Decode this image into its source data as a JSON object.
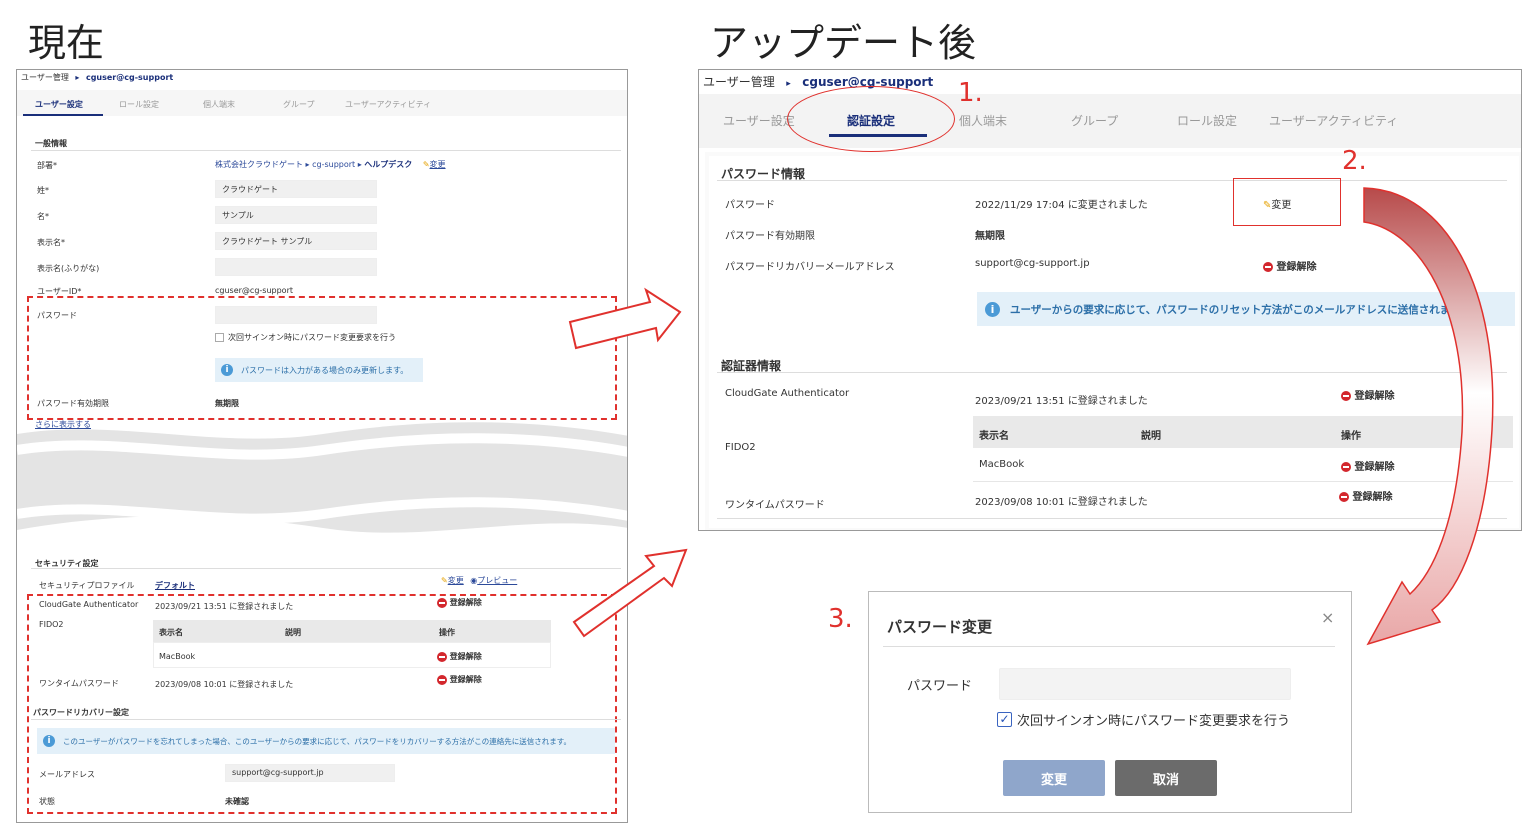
{
  "labels": {
    "current": "現在",
    "after": "アップデート後",
    "step1": "1.",
    "step2": "2.",
    "step3": "3."
  },
  "left": {
    "breadcrumb": {
      "parent": "ユーザー管理",
      "sep": "▸",
      "current": "cguser@cg-support"
    },
    "tabs": [
      "ユーザー設定",
      "ロール設定",
      "個人端末",
      "グループ",
      "ユーザーアクティビティ"
    ],
    "general": {
      "title": "一般情報",
      "dept_label": "部署*",
      "dept_path": [
        "株式会社クラウドゲート",
        "cg-support",
        "ヘルプデスク"
      ],
      "dept_sep": "▸",
      "edit": "変更",
      "fields": [
        {
          "label": "姓*",
          "value": "クラウドゲート"
        },
        {
          "label": "名*",
          "value": "サンプル"
        },
        {
          "label": "表示名*",
          "value": "クラウドゲート サンプル"
        },
        {
          "label": "表示名(ふりがな)",
          "value": ""
        }
      ],
      "userid_label": "ユーザーID*",
      "userid_value": "cguser@cg-support",
      "password_label": "パスワード",
      "checkbox_label": "次回サインオン時にパスワード変更要求を行う",
      "pw_info": "パスワードは入力がある場合のみ更新します。",
      "expiry_label": "パスワード有効期限",
      "expiry_value": "無期限",
      "more": "さらに表示する"
    },
    "security": {
      "title": "セキュリティ設定",
      "profile_label": "セキュリティプロファイル",
      "profile_value": "デフォルト",
      "edit": "変更",
      "preview": "プレビュー",
      "cga_label": "CloudGate Authenticator",
      "cga_value": "2023/09/21 13:51 に登録されました",
      "unregister": "登録解除",
      "fido_label": "FIDO2",
      "table_headers": [
        "表示名",
        "説明",
        "操作"
      ],
      "table_row": {
        "name": "MacBook",
        "desc": "",
        "action": "登録解除"
      },
      "otp_label": "ワンタイムパスワード",
      "otp_value": "2023/09/08 10:01 に登録されました"
    },
    "recovery": {
      "title": "パスワードリカバリー設定",
      "info": "このユーザーがパスワードを忘れてしまった場合、このユーザーからの要求に応じて、パスワードをリカバリーする方法がこの連絡先に送信されます。",
      "email_label": "メールアドレス",
      "email_value": "support@cg-support.jp",
      "status_label": "状態",
      "status_value": "未確認"
    }
  },
  "right": {
    "breadcrumb": {
      "parent": "ユーザー管理",
      "sep": "▸",
      "current": "cguser@cg-support"
    },
    "tabs": [
      "ユーザー設定",
      "認証設定",
      "個人端末",
      "グループ",
      "ロール設定",
      "ユーザーアクティビティ"
    ],
    "password_section": {
      "title": "パスワード情報",
      "pw_label": "パスワード",
      "pw_value": "2022/11/29 17:04 に変更されました",
      "edit": "変更",
      "expiry_label": "パスワード有効期限",
      "expiry_value": "無期限",
      "recovery_label": "パスワードリカバリーメールアドレス",
      "recovery_value": "support@cg-support.jp",
      "unregister": "登録解除",
      "info": "ユーザーからの要求に応じて、パスワードのリセット方法がこのメールアドレスに送信されます"
    },
    "auth_section": {
      "title": "認証器情報",
      "cga_label": "CloudGate Authenticator",
      "cga_value": "2023/09/21 13:51 に登録されました",
      "unregister": "登録解除",
      "fido_label": "FIDO2",
      "table_headers": [
        "表示名",
        "説明",
        "操作"
      ],
      "table_row": {
        "name": "MacBook",
        "desc": "",
        "action": "登録解除"
      },
      "otp_label": "ワンタイムパスワード",
      "otp_value": "2023/09/08 10:01 に登録されました"
    }
  },
  "dialog": {
    "title": "パスワード変更",
    "close": "×",
    "pw_label": "パスワード",
    "pw_value": "",
    "checkbox_label": "次回サインオン時にパスワード変更要求を行う",
    "checkbox_checked": true,
    "submit": "変更",
    "cancel": "取消"
  },
  "colors": {
    "accent_red": "#e0312d",
    "navy": "#1a2f7a",
    "info_blue": "#4b9ad6",
    "submit_btn": "#8fa6cb",
    "cancel_btn": "#6b6b6b"
  }
}
